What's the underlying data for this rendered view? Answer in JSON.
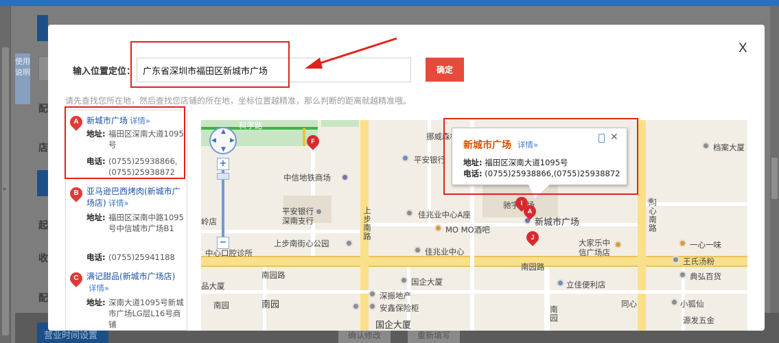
{
  "modal": {
    "close_label": "X",
    "location_label": "输入位置定位：",
    "location_value": "广东省深圳市福田区新城市广场",
    "confirm_label": "确定",
    "hint": "请先查找您所在地，然后查找您店铺的所在地，坐标位置越精准，那么判断的距离就越精准哦。"
  },
  "results": {
    "address_label": "地址:",
    "phone_label": "电话:",
    "more_label": "详情»",
    "items": [
      {
        "marker": "A",
        "name": "新城市广场",
        "address": "福田区深南大道1095号",
        "phone": "(0755)25938866,(0755)25938872"
      },
      {
        "marker": "B",
        "name": "亚马逊巴西烤肉(新城市广场店)",
        "address": "福田区深南中路1095号中信城市广场B1",
        "phone": "(0755)25941188"
      },
      {
        "marker": "C",
        "name": "满记甜品(新城市广场店)",
        "address": "深南大道1095号新城市广场LG层L16号商铺",
        "phone": ""
      }
    ]
  },
  "info_window": {
    "title": "新城市广场",
    "more": "详情»",
    "close": "✕",
    "address_label": "地址:",
    "address": "福田区深南大道1095号",
    "phone_label": "电话:",
    "phone": "(0755)25938866,(0755)25938872"
  },
  "map": {
    "labels": {
      "keyuelu": "科学路",
      "nuowei": "挪威森林",
      "pingan_bank": "平安银行",
      "zhongxin_metro": "中信地铁商场",
      "pingan_shenzhen": "平安银行深南支行",
      "lingdian": "岭店",
      "jiazhaoye_a": "佳兆业中心A座",
      "momo": "MO MO酒吧",
      "xinchengshi": "新城市广场",
      "shangbu_park": "上步南街心公园",
      "jiazhaoye": "佳兆业中心",
      "center_clinic": "中心口腔诊所",
      "dayuele": "大家乐中信广场店",
      "yixinyiwei": "一心一味",
      "wangshi": "王氏汤粉",
      "dianhong": "典弘百货",
      "nanyuan_road_1": "南园路",
      "nanyuan_road_2": "南园路",
      "guoqi": "国企大厦",
      "lijiayi": "立佳便利店",
      "shenzhen_dichan": "深振地产",
      "anxin": "安鑫保险柜",
      "nanyuan": "南园",
      "guoqi_big": "国企大厦",
      "tongxin": "同心",
      "xiaohuli": "小狐仙",
      "shangbu": "上步南路",
      "tongxinnan": "同心南路",
      "nanyuan_v": "南园",
      "dangan": "档案大厦",
      "weixi": "威西",
      "pinyou": "品大厦",
      "yuanfa": "源发五金",
      "nanyuan_bottom": "南园",
      "xin_side": "广场",
      "beili": "驰宇广场"
    },
    "pins": [
      "F",
      "I",
      "A",
      "J"
    ],
    "zoom_in": "+",
    "zoom_out": "−"
  },
  "background": {
    "help_text": "使用说明",
    "labels": [
      "配",
      "店",
      "起",
      "收",
      "配"
    ],
    "footer_title": "营业时间设置",
    "footer_btn_1": "确认修改",
    "footer_btn_2": "重新填写"
  },
  "colors": {
    "accent": "#e64a3b",
    "link": "#3a78d4",
    "annotation": "#e3201b"
  }
}
